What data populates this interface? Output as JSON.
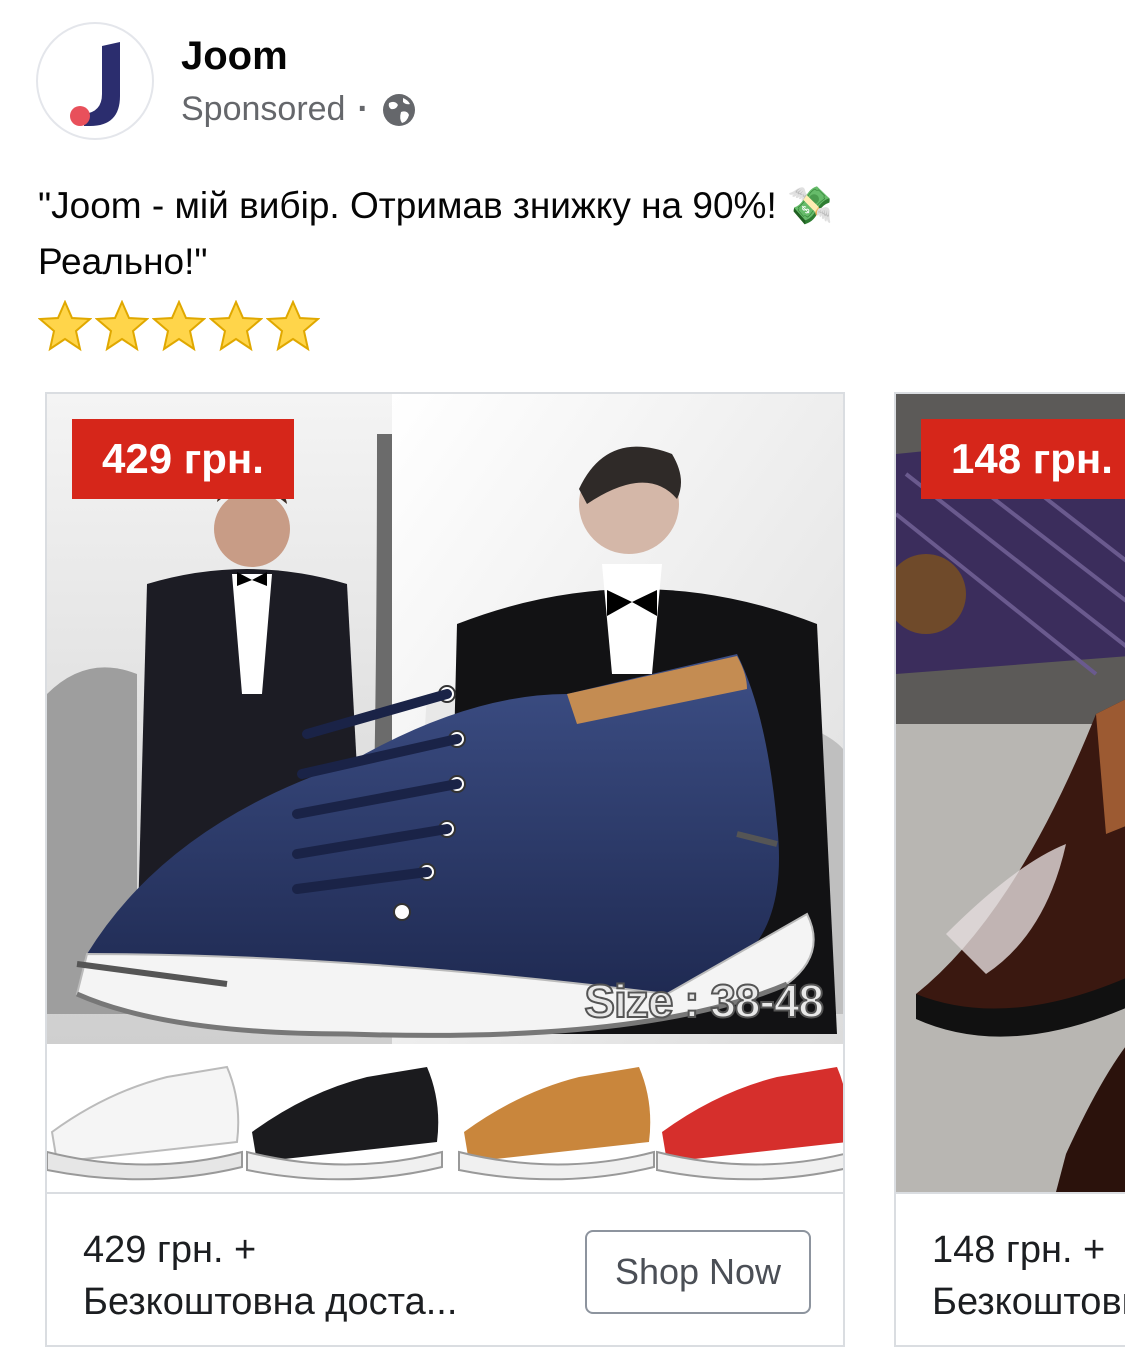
{
  "advertiser": {
    "name": "Joom",
    "sponsored_label": "Sponsored",
    "separator": "·",
    "audience_icon": "globe-icon",
    "logo_colors": {
      "bar": "#2b2d6e",
      "dot": "#e8505b"
    }
  },
  "post": {
    "text_line1": "\"Joom - мій вибір. Отримав знижку на 90%! 💸",
    "text_line2": "Реально!\"",
    "stars_count": 5
  },
  "carousel": {
    "cards": [
      {
        "price_tag": "429 грн.",
        "size_label": "Size : 38-48",
        "footer_line1": "429 грн. +",
        "footer_line2": "Безкоштовна доста...",
        "cta": "Shop Now",
        "variant_colors": [
          "white",
          "black",
          "tan",
          "red"
        ]
      },
      {
        "price_tag": "148 грн.",
        "footer_line1": "148 грн. +",
        "footer_line2": "Безкоштовна доставка"
      }
    ]
  },
  "colors": {
    "price_tag_bg": "#d6261a",
    "border": "#dadde1",
    "muted_text": "#65676b"
  }
}
